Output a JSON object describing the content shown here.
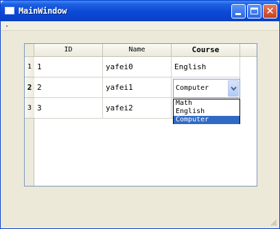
{
  "window": {
    "title": "MainWindow"
  },
  "table": {
    "columns": [
      "ID",
      "Name",
      "Course"
    ],
    "rows": [
      {
        "header": "1",
        "id": "1",
        "name": "yafei0",
        "course": "English"
      },
      {
        "header": "2",
        "id": "2",
        "name": "yafei1",
        "course": "Computer"
      },
      {
        "header": "3",
        "id": "3",
        "name": "yafei2",
        "course": ""
      }
    ]
  },
  "combo": {
    "value": "Computer",
    "options": [
      "Math",
      "English",
      "Computer"
    ],
    "selected": "Computer"
  },
  "colors": {
    "titlebar": "#0a44cc",
    "selection": "#316ac5",
    "close_button": "#c5401f"
  },
  "icons": [
    "app-icon",
    "minimize-icon",
    "maximize-icon",
    "close-icon",
    "chevron-down-icon",
    "resize-grip-icon"
  ]
}
